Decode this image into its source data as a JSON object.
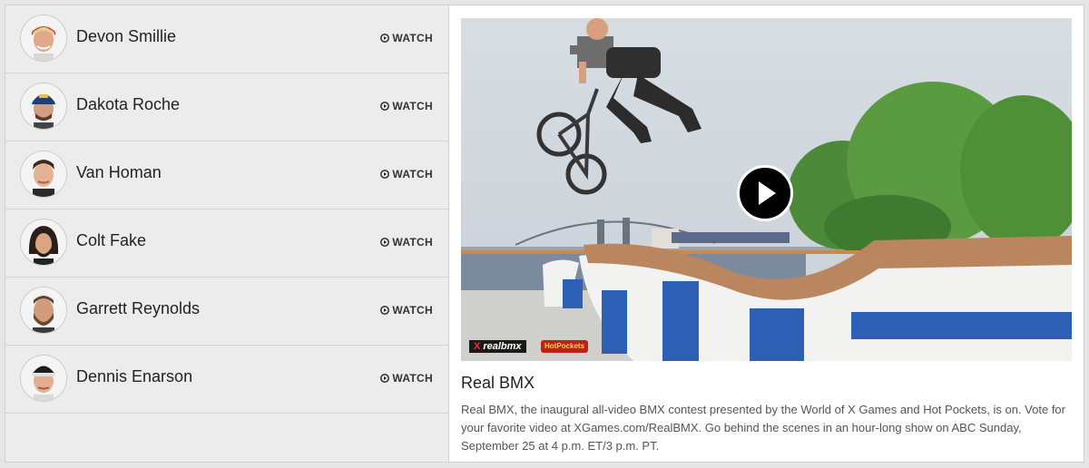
{
  "riders": [
    {
      "name": "Devon Smillie",
      "watch_label": "WATCH"
    },
    {
      "name": "Dakota Roche",
      "watch_label": "WATCH"
    },
    {
      "name": "Van Homan",
      "watch_label": "WATCH"
    },
    {
      "name": "Colt Fake",
      "watch_label": "WATCH"
    },
    {
      "name": "Garrett Reynolds",
      "watch_label": "WATCH"
    },
    {
      "name": "Dennis Enarson",
      "watch_label": "WATCH"
    }
  ],
  "video": {
    "title": "Real BMX",
    "description": "Real BMX, the inaugural all-video BMX contest presented by the World of X Games and Hot Pockets, is on. Vote for your favorite video at XGames.com/RealBMX. Go behind the scenes in an hour-long show on ABC Sunday, September 25 at 4 p.m. ET/3 p.m. PT.",
    "logo_xgames": "X",
    "logo_realbmx": "realbmx",
    "logo_sponsor": "HotPockets"
  },
  "icons": {
    "watch": "play-circle-icon",
    "video_play": "play-icon"
  },
  "colors": {
    "list_bg": "#ececec",
    "realbmx_red": "#e8312f",
    "hotpockets_red": "#b8241c",
    "ramp_blue": "#2d5fb5"
  }
}
